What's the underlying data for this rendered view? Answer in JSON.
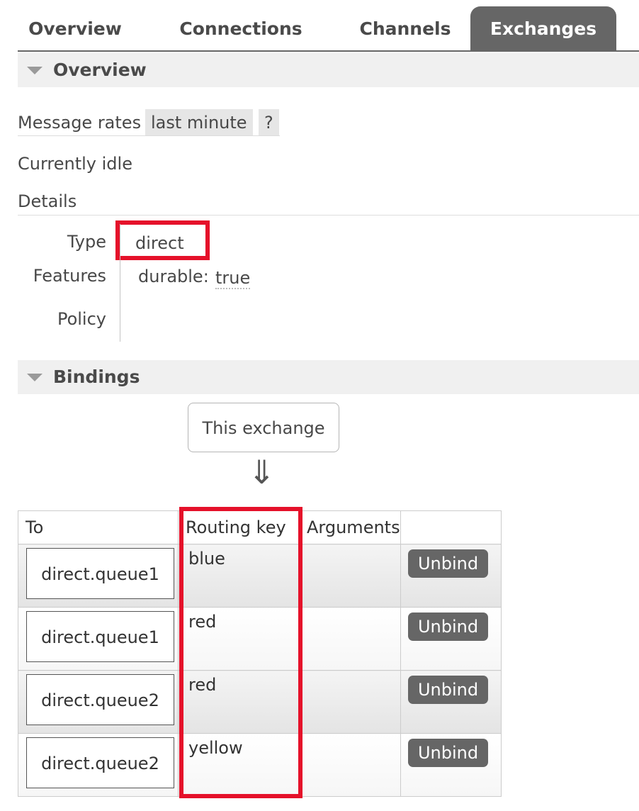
{
  "tabs": [
    "Overview",
    "Connections",
    "Channels",
    "Exchanges"
  ],
  "overview": {
    "title": "Overview",
    "message_rates_label": "Message rates",
    "message_rates_value": "last minute",
    "help": "?",
    "idle_text": "Currently idle",
    "details_label": "Details",
    "type_label": "Type",
    "type_value": "direct",
    "features_label": "Features",
    "feature_key": "durable:",
    "feature_value": "true",
    "policy_label": "Policy"
  },
  "bindings": {
    "title": "Bindings",
    "this_exchange": "This exchange",
    "arrow": "⇓",
    "columns": [
      "To",
      "Routing key",
      "Arguments",
      ""
    ],
    "rows": [
      {
        "to": "direct.queue1",
        "routing_key": "blue",
        "arguments": "",
        "action": "Unbind"
      },
      {
        "to": "direct.queue1",
        "routing_key": "red",
        "arguments": "",
        "action": "Unbind"
      },
      {
        "to": "direct.queue2",
        "routing_key": "red",
        "arguments": "",
        "action": "Unbind"
      },
      {
        "to": "direct.queue2",
        "routing_key": "yellow",
        "arguments": "",
        "action": "Unbind"
      }
    ]
  },
  "colors": {
    "highlight": "#e5112a",
    "tab_active": "#666666",
    "button": "#666666"
  }
}
